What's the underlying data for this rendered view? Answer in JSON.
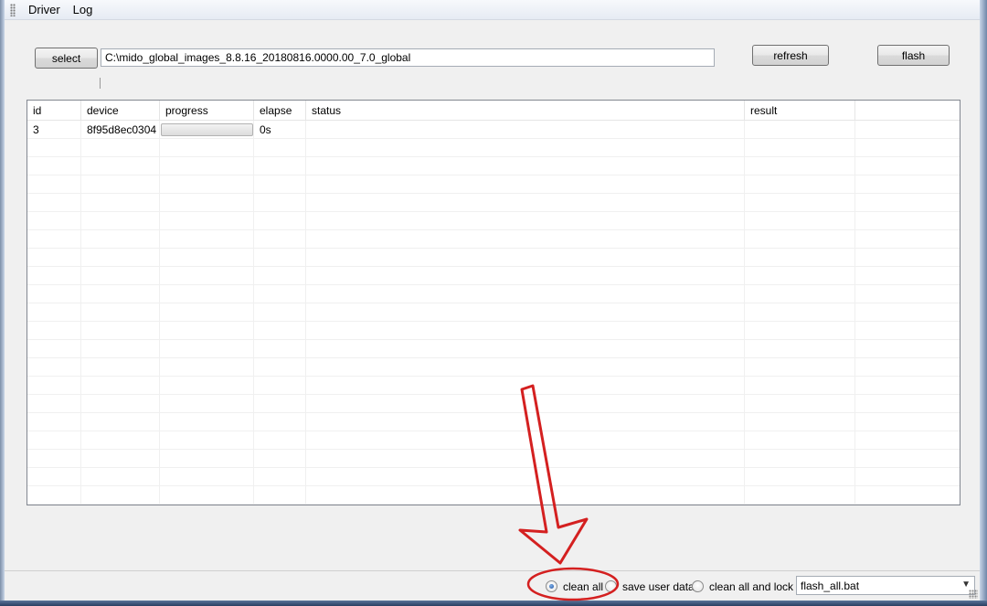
{
  "menu": {
    "items": [
      {
        "label": "Driver"
      },
      {
        "label": "Log"
      }
    ]
  },
  "toolbar": {
    "select_label": "select",
    "path_value": "C:\\mido_global_images_8.8.16_20180816.0000.00_7.0_global",
    "refresh_label": "refresh",
    "flash_label": "flash"
  },
  "table": {
    "columns": [
      "id",
      "device",
      "progress",
      "elapse",
      "status",
      "result"
    ],
    "rows": [
      {
        "id": "3",
        "device": "8f95d8ec0304",
        "progress": 0,
        "elapse": "0s",
        "status": "",
        "result": ""
      }
    ]
  },
  "options": {
    "radios": [
      {
        "label": "clean all",
        "checked": true
      },
      {
        "label": "save user data",
        "checked": false
      },
      {
        "label": "clean all and lock",
        "checked": false
      }
    ],
    "script_selected": "flash_all.bat"
  },
  "colors": {
    "annotation": "#d42020",
    "progress_fill": "#38c738"
  },
  "icons": {
    "dropdown": "chevron-down-icon",
    "annotation_arrow": "down-arrow-icon"
  }
}
